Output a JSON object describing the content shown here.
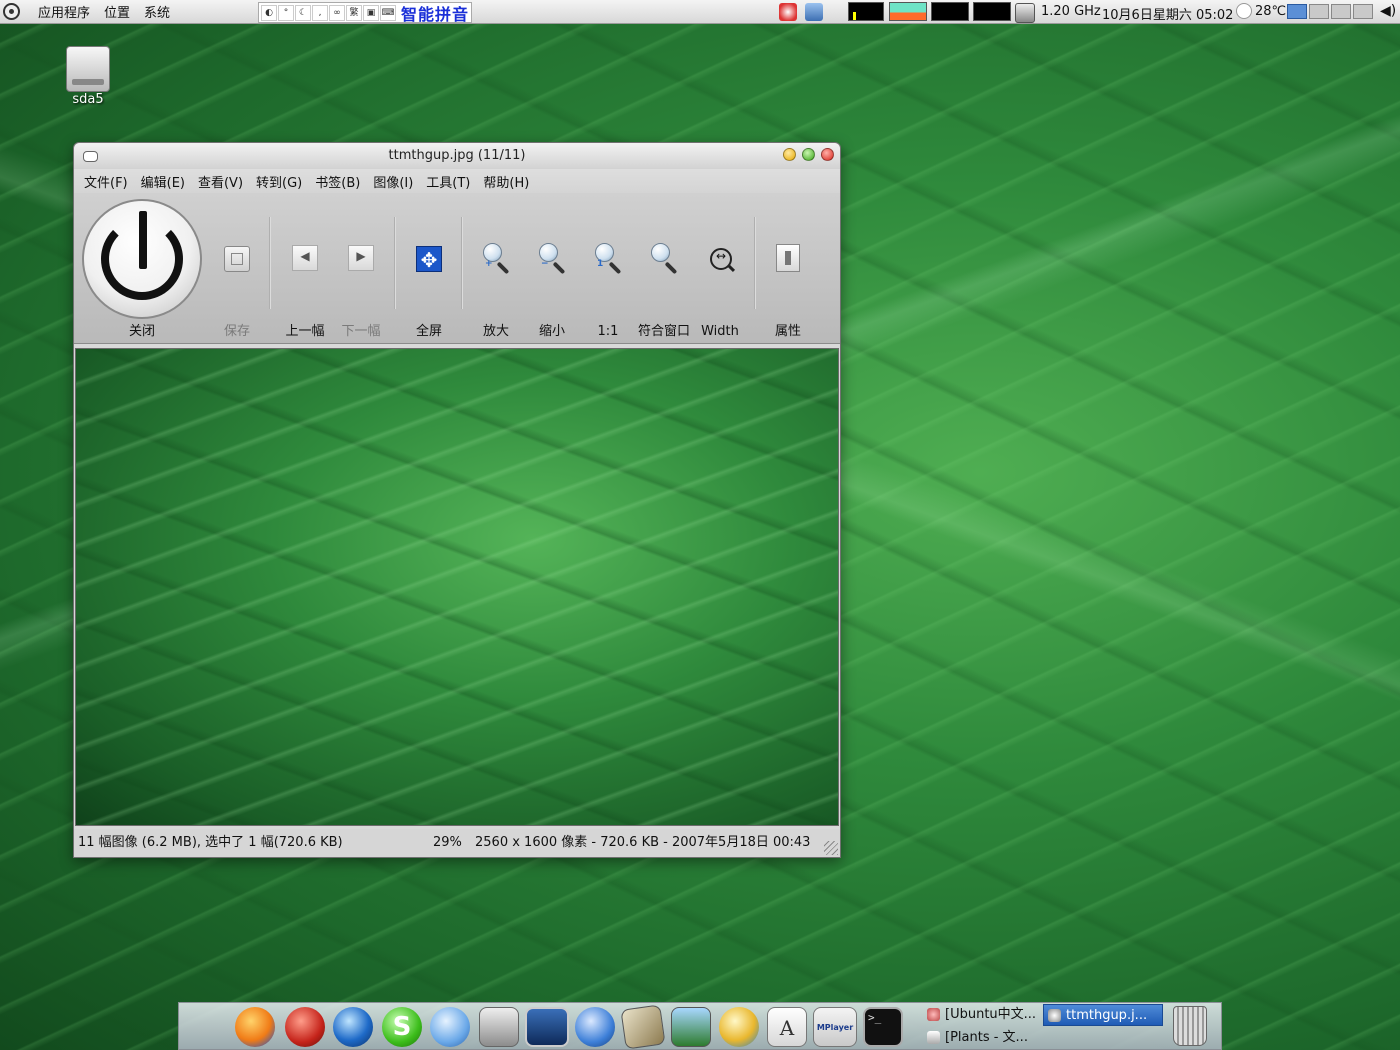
{
  "top_panel": {
    "menus": [
      "应用程序",
      "位置",
      "系统"
    ],
    "ime_name": "智能拼音",
    "ime_buttons": [
      "繁"
    ],
    "cpu_freq": "1.20 GHz",
    "clock": "10月6日星期六 05:02",
    "temperature": "28℃",
    "volume_icon": "speaker-icon"
  },
  "desktop": {
    "icons": [
      {
        "label": "sda5",
        "icon": "hard-disk-icon"
      }
    ]
  },
  "viewer": {
    "title": "ttmthgup.jpg  (11/11)",
    "menu": [
      "文件(F)",
      "编辑(E)",
      "查看(V)",
      "转到(G)",
      "书签(B)",
      "图像(I)",
      "工具(T)",
      "帮助(H)"
    ],
    "toolbar": {
      "close": "关闭",
      "save": "保存",
      "prev": "上一幅",
      "next": "下一幅",
      "fullscreen": "全屏",
      "zoom_in": "放大",
      "zoom_out": "缩小",
      "zoom_1_1": "1:1",
      "fit_window": "符合窗口",
      "fit_width": "Width",
      "properties": "属性"
    },
    "status": {
      "selection": "11 幅图像 (6.2 MB), 选中了 1 幅(720.6 KB)",
      "zoom": "29%",
      "info": "2560 x 1600 像素 - 720.6 KB - 2007年5月18日 00:43"
    }
  },
  "dock": {
    "apps": [
      "apple-icon",
      "firefox-icon",
      "flash-icon",
      "google-earth-icon",
      "skype-icon",
      "chat-icon",
      "download-icon",
      "screen-icon",
      "network-globe-icon",
      "photo-icon",
      "image-viewer-icon",
      "fish-icon",
      "text-editor-icon",
      "mplayer-icon",
      "terminal-icon",
      "trash-icon"
    ],
    "mplayer_label": "MPlayer",
    "terminal_prompt": ">_",
    "text_editor_letter": "A",
    "tasks": [
      {
        "label": "[Ubuntu中文...",
        "active": false
      },
      {
        "label": "ttmthgup.j...",
        "active": true
      },
      {
        "label": "[Plants - 文...",
        "active": false
      }
    ]
  },
  "colors": {
    "ime_blue": "#1a2fd8",
    "task_active": "#2f6cc6"
  }
}
